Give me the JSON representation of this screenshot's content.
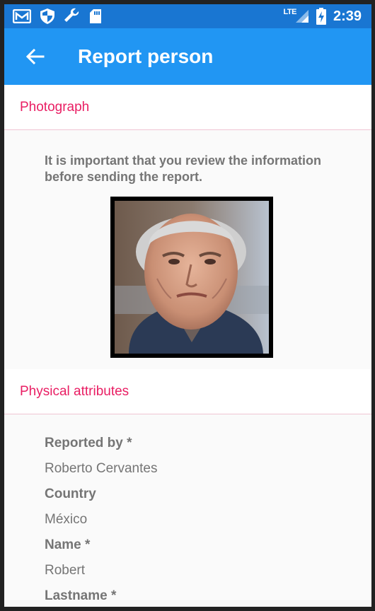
{
  "status_bar": {
    "icons_left": [
      "gmail-icon",
      "shield-icon",
      "wrench-icon",
      "sd-card-icon"
    ],
    "network": "LTE",
    "time": "2:39"
  },
  "app_bar": {
    "title": "Report person"
  },
  "sections": {
    "photograph": "Photograph",
    "physical_attributes": "Physical attributes"
  },
  "notice": "It is important that you review the information before sending the report.",
  "fields": [
    {
      "label": "Reported by *",
      "value": "Roberto Cervantes"
    },
    {
      "label": "Country",
      "value": "México"
    },
    {
      "label": "Name *",
      "value": "Robert"
    },
    {
      "label": "Lastname *",
      "value": ""
    }
  ],
  "colors": {
    "status_bar": "#1976d2",
    "app_bar": "#2196f3",
    "accent": "#e91e63",
    "text": "#757575"
  }
}
